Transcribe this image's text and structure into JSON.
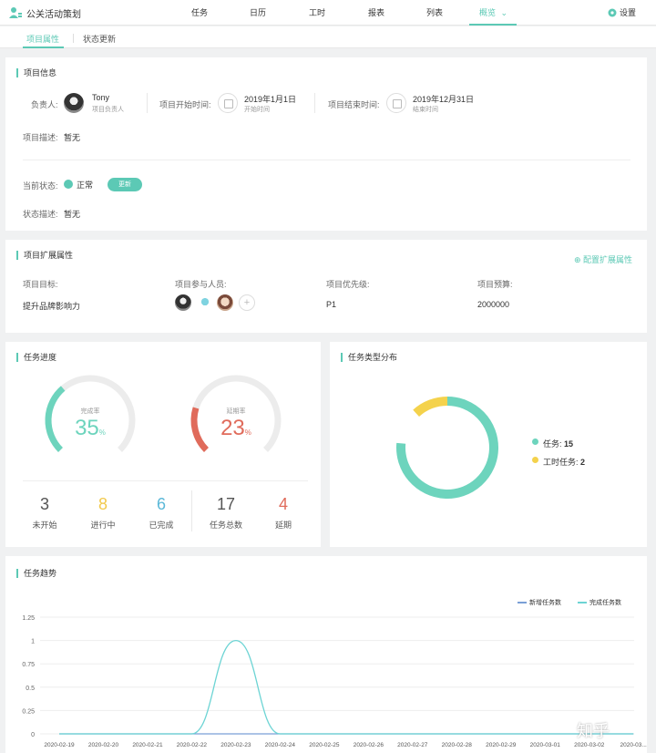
{
  "header": {
    "app_title": "公关活动策划",
    "nav": [
      "任务",
      "日历",
      "工时",
      "报表",
      "列表",
      "概览"
    ],
    "active_nav_suffix": "⌄",
    "settings_label": "设置"
  },
  "subtabs": [
    "项目属性",
    "状态更新"
  ],
  "project_info": {
    "title": "项目信息",
    "owner_label": "负责人:",
    "owner_name": "Tony",
    "owner_role": "项目负责人",
    "start_label": "项目开始时间:",
    "start_date": "2019年1月1日",
    "start_note": "开始时间",
    "end_label": "项目结束时间:",
    "end_date": "2019年12月31日",
    "end_note": "结束时间",
    "desc_label": "项目描述:",
    "desc_value": "暂无",
    "status_label": "当前状态:",
    "status_value": "正常",
    "update_button": "更新",
    "status_desc_label": "状态描述:",
    "status_desc_value": "暂无"
  },
  "extended": {
    "title": "项目扩展属性",
    "config_link": "⊕ 配置扩展属性",
    "goal_label": "项目目标:",
    "goal_value": "提升品牌影响力",
    "members_label": "项目参与人员:",
    "add_member": "+",
    "priority_label": "项目优先级:",
    "priority_value": "P1",
    "budget_label": "项目预算:",
    "budget_value": "2000000"
  },
  "progress": {
    "title": "任务进度",
    "completion_label": "完成率",
    "completion_value": "35",
    "completion_fraction": 0.35,
    "delay_label": "延期率",
    "delay_value": "23",
    "delay_fraction": 0.23,
    "percent_sign": "%",
    "stats": [
      {
        "num": "3",
        "label": "未开始",
        "color": "#555555"
      },
      {
        "num": "8",
        "label": "进行中",
        "color": "#f2c94c"
      },
      {
        "num": "6",
        "label": "已完成",
        "color": "#5bb8d8"
      },
      {
        "num": "17",
        "label": "任务总数",
        "color": "#555555"
      },
      {
        "num": "4",
        "label": "延期",
        "color": "#e06b5b"
      }
    ]
  },
  "type_distribution": {
    "title": "任务类型分布",
    "items": [
      {
        "label": "任务:",
        "value": "15",
        "color": "#6dd4bd"
      },
      {
        "label": "工时任务:",
        "value": "2",
        "color": "#f4d24c"
      }
    ]
  },
  "trend": {
    "title": "任务趋势",
    "legend": [
      {
        "label": "新增任务数",
        "color": "#7a9fd6"
      },
      {
        "label": "完成任务数",
        "color": "#6dd4d4"
      }
    ]
  },
  "chart_data": {
    "type": "line",
    "x": [
      "2020-02-19",
      "2020-02-20",
      "2020-02-21",
      "2020-02-22",
      "2020-02-23",
      "2020-02-24",
      "2020-02-25",
      "2020-02-26",
      "2020-02-27",
      "2020-02-28",
      "2020-02-29",
      "2020-03-01",
      "2020-03-02",
      "2020-03..."
    ],
    "series": [
      {
        "name": "新增任务数",
        "values": [
          0,
          0,
          0,
          0,
          0,
          0,
          0,
          0,
          0,
          0,
          0,
          0,
          0,
          0
        ]
      },
      {
        "name": "完成任务数",
        "values": [
          0,
          0,
          0,
          0,
          1,
          0,
          0,
          0,
          0,
          0,
          0,
          0,
          0,
          0
        ]
      }
    ],
    "y_ticks": [
      "0",
      "0.25",
      "0.5",
      "0.75",
      "1",
      "1.25"
    ],
    "ylim": [
      0,
      1.25
    ],
    "grid": true,
    "legend_position": "top-right"
  },
  "watermark": "知乎"
}
